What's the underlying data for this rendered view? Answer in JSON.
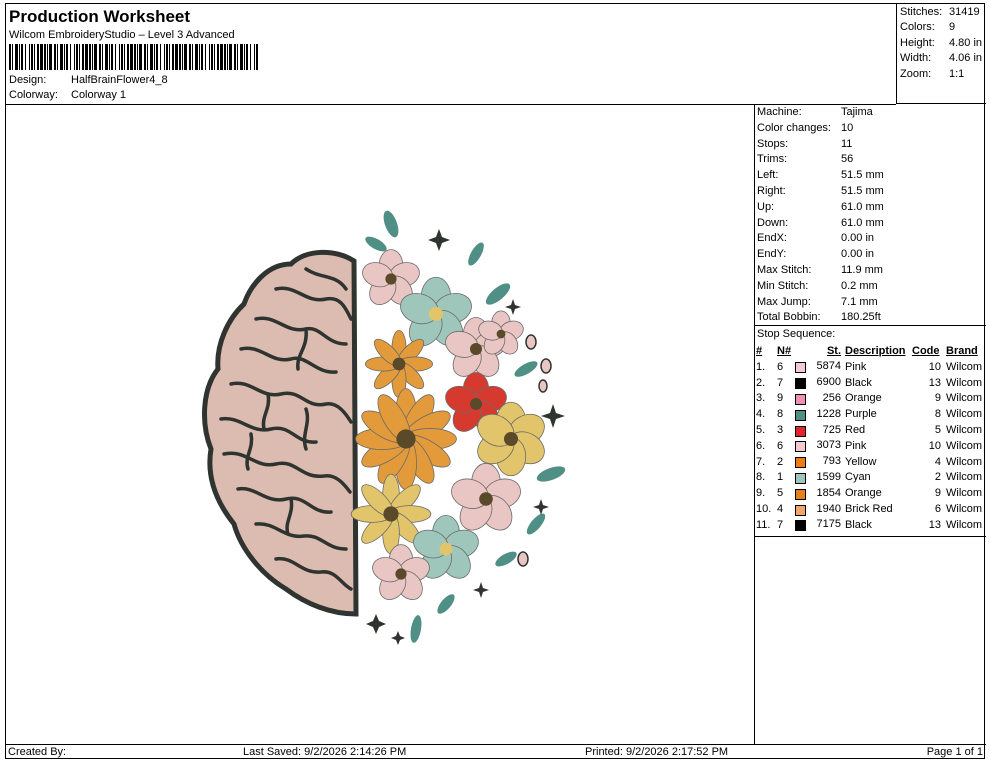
{
  "header": {
    "title": "Production Worksheet",
    "subtitle": "Wilcom EmbroideryStudio – Level 3 Advanced",
    "design_label": "Design:",
    "design_value": "HalfBrainFlower4_8",
    "colorway_label": "Colorway:",
    "colorway_value": "Colorway 1"
  },
  "summary": {
    "stitches_label": "Stitches:",
    "stitches": "31419",
    "colors_label": "Colors:",
    "colors": "9",
    "height_label": "Height:",
    "height": "4.80 in",
    "width_label": "Width:",
    "width": "4.06 in",
    "zoom_label": "Zoom:",
    "zoom": "1:1"
  },
  "machine": [
    {
      "label": "Machine:",
      "value": "Tajima"
    },
    {
      "label": "Color changes:",
      "value": "10"
    },
    {
      "label": "Stops:",
      "value": "11"
    },
    {
      "label": "Trims:",
      "value": "56"
    },
    {
      "label": "Left:",
      "value": "51.5 mm"
    },
    {
      "label": "Right:",
      "value": "51.5 mm"
    },
    {
      "label": "Up:",
      "value": "61.0 mm"
    },
    {
      "label": "Down:",
      "value": "61.0 mm"
    },
    {
      "label": "EndX:",
      "value": "0.00 in"
    },
    {
      "label": "EndY:",
      "value": "0.00 in"
    },
    {
      "label": "Max Stitch:",
      "value": "11.9 mm"
    },
    {
      "label": "Min Stitch:",
      "value": "0.2 mm"
    },
    {
      "label": "Max Jump:",
      "value": "7.1 mm"
    },
    {
      "label": "Total Bobbin:",
      "value": "180.25ft"
    }
  ],
  "stop_sequence": {
    "caption": "Stop Sequence:",
    "headers": {
      "num": "#",
      "n": "N#",
      "st": "St.",
      "desc": "Description",
      "code": "Code",
      "brand": "Brand"
    },
    "rows": [
      {
        "num": "1.",
        "n": "6",
        "color": "#f4c9cf",
        "st": "5874",
        "desc": "Pink",
        "code": "10",
        "brand": "Wilcom"
      },
      {
        "num": "2.",
        "n": "7",
        "color": "#000000",
        "st": "6900",
        "desc": "Black",
        "code": "13",
        "brand": "Wilcom"
      },
      {
        "num": "3.",
        "n": "9",
        "color": "#ef8fb4",
        "st": "256",
        "desc": "Orange",
        "code": "9",
        "brand": "Wilcom"
      },
      {
        "num": "4.",
        "n": "8",
        "color": "#4f8f86",
        "st": "1228",
        "desc": "Purple",
        "code": "8",
        "brand": "Wilcom"
      },
      {
        "num": "5.",
        "n": "3",
        "color": "#e0262b",
        "st": "725",
        "desc": "Red",
        "code": "5",
        "brand": "Wilcom"
      },
      {
        "num": "6.",
        "n": "6",
        "color": "#f4c9cf",
        "st": "3073",
        "desc": "Pink",
        "code": "10",
        "brand": "Wilcom"
      },
      {
        "num": "7.",
        "n": "2",
        "color": "#ee7d11",
        "st": "793",
        "desc": "Yellow",
        "code": "4",
        "brand": "Wilcom"
      },
      {
        "num": "8.",
        "n": "1",
        "color": "#9fc6ba",
        "st": "1599",
        "desc": "Cyan",
        "code": "2",
        "brand": "Wilcom"
      },
      {
        "num": "9.",
        "n": "5",
        "color": "#e6801f",
        "st": "1854",
        "desc": "Orange",
        "code": "9",
        "brand": "Wilcom"
      },
      {
        "num": "10.",
        "n": "4",
        "color": "#f0a66a",
        "st": "1940",
        "desc": "Brick Red",
        "code": "6",
        "brand": "Wilcom"
      },
      {
        "num": "11.",
        "n": "7",
        "color": "#000000",
        "st": "7175",
        "desc": "Black",
        "code": "13",
        "brand": "Wilcom"
      }
    ]
  },
  "footer": {
    "created_by": "Created By:",
    "last_saved": "Last Saved: 9/2/2026 2:14:26 PM",
    "printed": "Printed: 9/2/2026 2:17:52 PM",
    "page": "Page 1 of 1"
  },
  "design_colors": {
    "brain": "#dcbcb0",
    "outline": "#2f3430",
    "pink": "#e9c6c4",
    "orange": "#e39a3a",
    "yellow": "#e2c56a",
    "cyan": "#9fc6ba",
    "red": "#d63a2f",
    "leaf": "#4f8f86"
  }
}
